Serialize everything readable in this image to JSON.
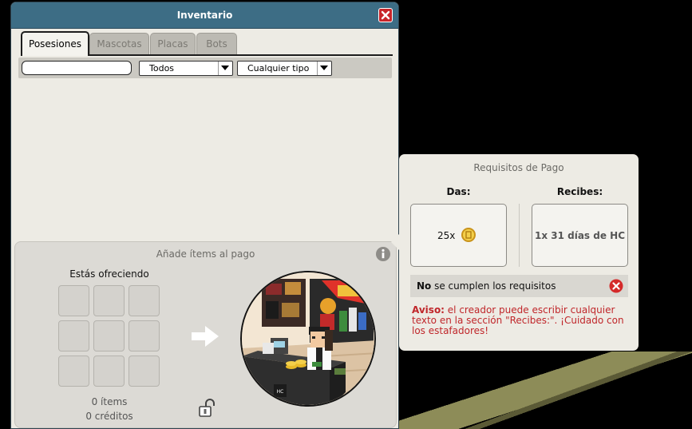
{
  "window": {
    "title": "Inventario"
  },
  "tabs": [
    {
      "label": "Posesiones",
      "active": true
    },
    {
      "label": "Mascotas",
      "active": false
    },
    {
      "label": "Placas",
      "active": false
    },
    {
      "label": "Bots",
      "active": false
    }
  ],
  "filters": {
    "search_value": "",
    "category": "Todos",
    "type": "Cualquier tipo"
  },
  "offer": {
    "title": "Añade ítems al pago",
    "offering_label": "Estás ofreciendo",
    "items_count": "0 ítems",
    "credits_count": "0 créditos",
    "slots": 9
  },
  "requirements": {
    "title": "Requisitos de Pago",
    "give_label": "Das:",
    "receive_label": "Recibes:",
    "give_amount": "25x",
    "receive_text": "1x 31 días de HC",
    "status_bold": "No",
    "status_rest": " se cumplen los requisitos",
    "warning_bold": "Aviso:",
    "warning_text": " el creador puede escribir cualquier texto en la sección \"Recibes:\". ¡Cuidado con los estafadores!"
  },
  "colors": {
    "titlebar": "#3d6d85",
    "close": "#c8252a",
    "warning": "#c0262a",
    "coin": "#e7b928"
  }
}
